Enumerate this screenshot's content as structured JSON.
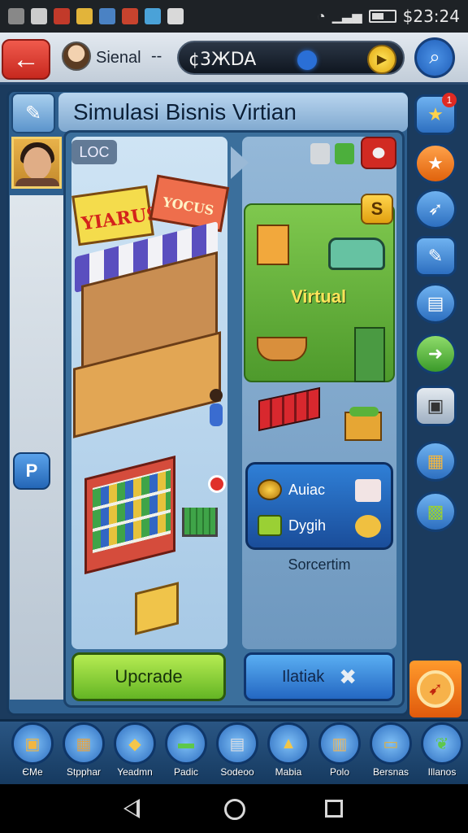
{
  "status_bar": {
    "time": "$23:24",
    "battery_level": 0.55
  },
  "top_bar": {
    "player_name": "Sienal",
    "player_separator": "--",
    "money": "¢3ЖDA"
  },
  "main": {
    "title": "Simulasi Bisnis Virtian",
    "location_label": "LOC",
    "left_store": {
      "sign_left": "YIARUS",
      "sign_right": "YOCUS"
    },
    "right_store": {
      "zone_label": "Virtual",
      "badge": "S"
    },
    "info_card": {
      "row1": "Auiac",
      "row2": "Dygih",
      "caption": "Sorcertim"
    },
    "left_panel_button": "P",
    "upgrade_button": "Upcrade",
    "manage_button": "Ilatiak"
  },
  "sidebar": {
    "notification_count": "1"
  },
  "bottom_nav": {
    "items": [
      {
        "label": "ЄMe",
        "icon": "box-icon"
      },
      {
        "label": "Stpphar",
        "icon": "crate-icon"
      },
      {
        "label": "Yeadmn",
        "icon": "chest-icon"
      },
      {
        "label": "Padic",
        "icon": "card-icon"
      },
      {
        "label": "Sodeoo",
        "icon": "printer-icon"
      },
      {
        "label": "Mabia",
        "icon": "tent-icon"
      },
      {
        "label": "Polo",
        "icon": "package-icon"
      },
      {
        "label": "Bersnas",
        "icon": "drawer-icon"
      },
      {
        "label": "Illanos",
        "icon": "leaf-icon"
      }
    ]
  },
  "colors": {
    "upgrade": "#64b524",
    "manage": "#2467c2",
    "accent_orange": "#e05a0c",
    "alert_red": "#e02a22"
  }
}
